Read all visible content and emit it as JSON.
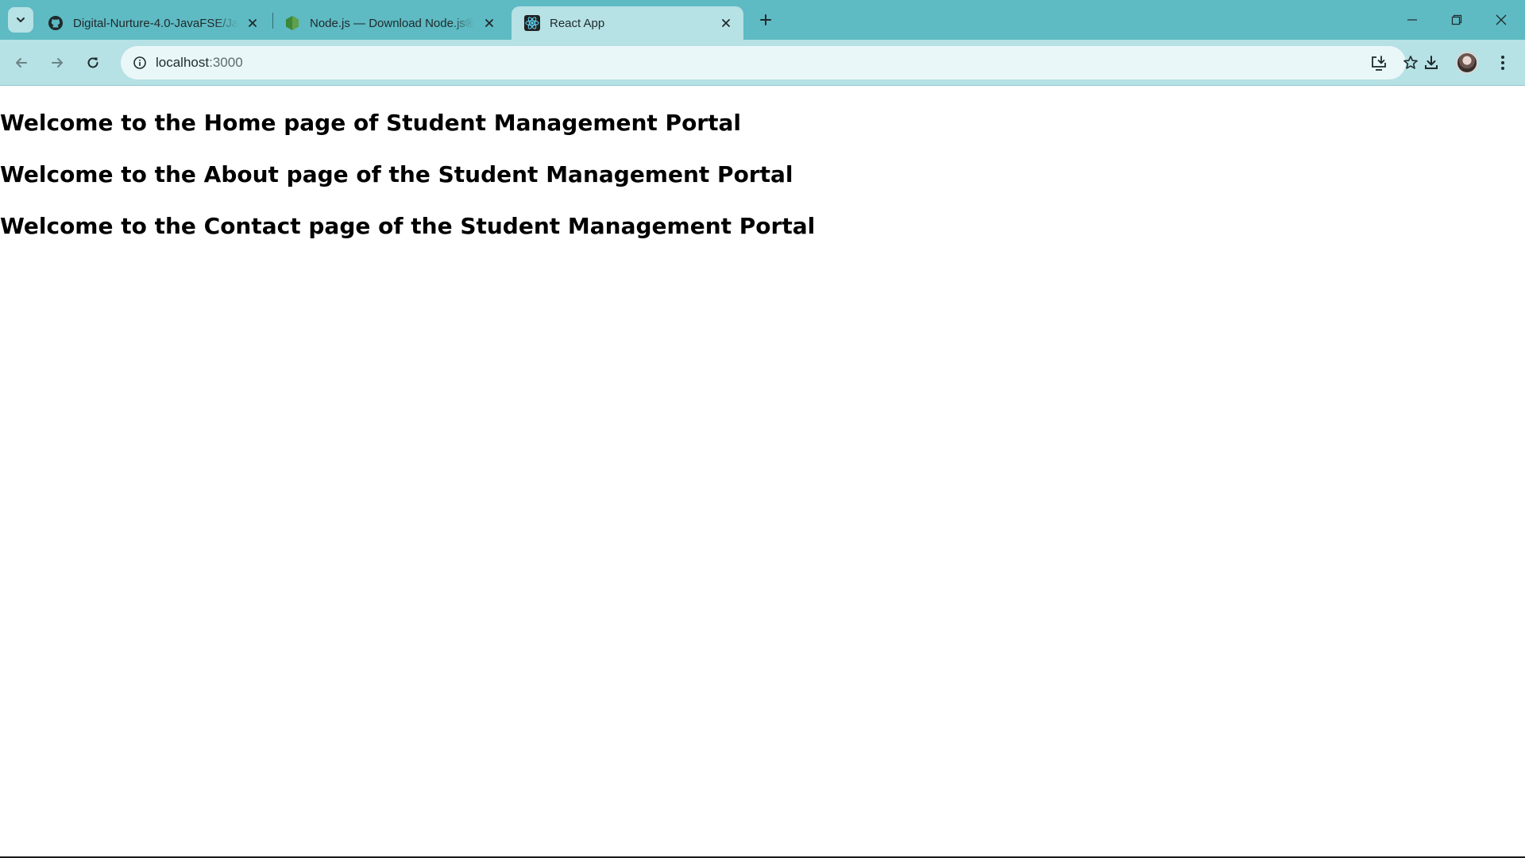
{
  "browser": {
    "tabs": [
      {
        "title": "Digital-Nurture-4.0-JavaFSE/Java",
        "favicon": "github-icon",
        "active": false
      },
      {
        "title": "Node.js — Download Node.js®",
        "favicon": "nodejs-icon",
        "active": false
      },
      {
        "title": "React App",
        "favicon": "react-icon",
        "active": true
      }
    ],
    "address": {
      "host": "localhost",
      "port": ":3000"
    },
    "colors": {
      "tabstrip": "#5ebac3",
      "toolbar": "#b6e1e5",
      "omnibox": "#eaf7f8"
    }
  },
  "page": {
    "headings": [
      "Welcome to the Home page of Student Management Portal",
      "Welcome to the About page of the Student Management Portal",
      "Welcome to the Contact page of the Student Management Portal"
    ]
  }
}
